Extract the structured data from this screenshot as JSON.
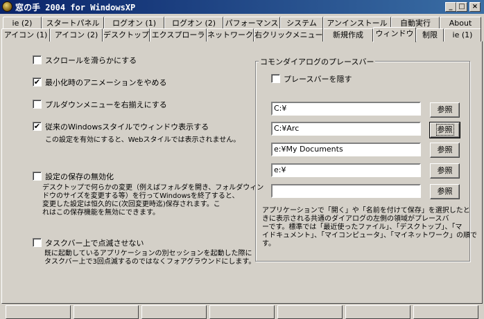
{
  "window": {
    "title": "窓の手 2004 for WindowsXP",
    "minimize": "_",
    "maximize": "□",
    "close": "×"
  },
  "tabs_row1": [
    "ie (2)",
    "スタートパネル",
    "ログオン (1)",
    "ログオン (2)",
    "パフォーマンス",
    "システム",
    "アンインストール",
    "自動実行",
    "About"
  ],
  "tabs_row2": [
    "アイコン (1)",
    "アイコン (2)",
    "デスクトップ",
    "エクスプローラ",
    "ネットワーク",
    "右クリックメニュー",
    "新規作成",
    "ウィンドウ",
    "制限",
    "ie (1)"
  ],
  "active_tab": "ウィンドウ",
  "options": [
    {
      "label": "スクロールを滑らかにする",
      "checked": false
    },
    {
      "label": "最小化時のアニメーションをやめる",
      "checked": true
    },
    {
      "label": "プルダウンメニューを右揃えにする",
      "checked": false
    },
    {
      "label": "従来のWindowsスタイルでウィンドウ表示する",
      "checked": true,
      "desc": "この設定を有効にすると、Webスタイルでは表示されません。"
    },
    {
      "label": "設定の保存の無効化",
      "checked": false,
      "desc": "デスクトップで何らかの変更（例えばフォルダを開き、フォルダウィン\nドウのサイズを変更する等）を行ってWindowsを終了すると、\n変更した設定は恒久的に(次回変更時迄)保存されます。こ\nれはこの保存機能を無効にできます。"
    },
    {
      "label": "タスクバー上で点滅させない",
      "checked": false,
      "desc": "既に起動しているアプリケーションの別セッションを起動した際に\nタスクバー上で3回点滅するのではなくフォアグラウンドにします。"
    }
  ],
  "places_bar": {
    "group_title": "コモンダイアログのプレースバー",
    "hide_label": "プレースバーを隠す",
    "hide_checked": false,
    "paths": [
      "C:¥",
      "C:¥Arc",
      "e:¥My Documents",
      "e:¥",
      ""
    ],
    "browse_label": "参照",
    "note": "アプリケーションで「開く」や「名前を付けて保存」を選択したと\nきに表示される共通のダイアログの左側の領域がプレースバ\nーです。標準では「最近使ったファイル」、「デスクトップ」、「マ\nイドキュメント」、「マイコンピュータ」、「マイネットワーク」の順で\nす。"
  }
}
